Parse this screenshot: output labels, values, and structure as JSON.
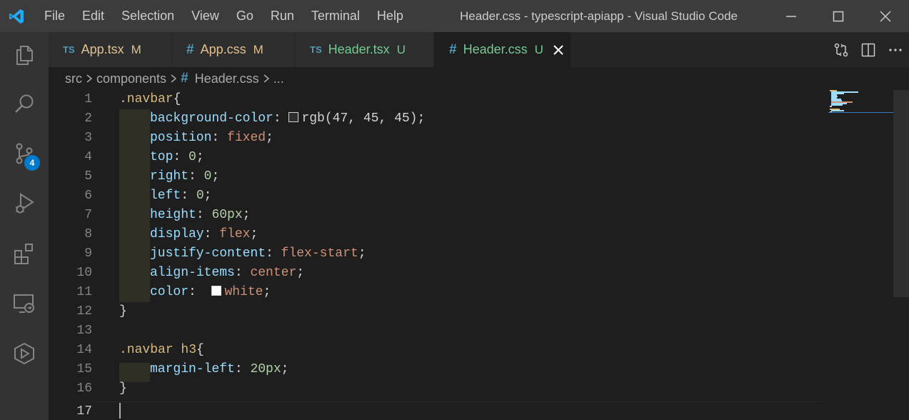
{
  "window": {
    "title": "Header.css - typescript-apiapp - Visual Studio Code",
    "menu": [
      "File",
      "Edit",
      "Selection",
      "View",
      "Go",
      "Run",
      "Terminal",
      "Help"
    ]
  },
  "activity_bar": {
    "items": [
      "explorer-icon",
      "search-icon",
      "source-control-icon",
      "run-debug-icon",
      "extensions-icon",
      "remote-explorer-icon",
      "deploy-icon"
    ],
    "source_control_badge": "4"
  },
  "tabs": [
    {
      "type": "TS",
      "name": "App.tsx",
      "status": "M",
      "color": "#e2c08d"
    },
    {
      "type": "#",
      "name": "App.css",
      "status": "M",
      "color": "#e2c08d"
    },
    {
      "type": "TS",
      "name": "Header.tsx",
      "status": "U",
      "color": "#73c991"
    },
    {
      "type": "#",
      "name": "Header.css",
      "status": "U",
      "color": "#73c991",
      "active": true
    }
  ],
  "breadcrumb": {
    "parts": [
      "src",
      "components",
      "Header.css",
      "..."
    ]
  },
  "editor": {
    "line_numbers": [
      "1",
      "2",
      "3",
      "4",
      "5",
      "6",
      "7",
      "8",
      "9",
      "10",
      "11",
      "12",
      "13",
      "14",
      "15",
      "16",
      "17"
    ],
    "l1": {
      "selector": ".navbar",
      "brace": "{"
    },
    "l2": {
      "prop": "background-color",
      "colon": ":",
      "val": "rgb(47, 45, 45)",
      "semi": ";",
      "swatch": "#2f2d2d"
    },
    "l3": {
      "prop": "position",
      "colon": ":",
      "val": "fixed",
      "semi": ";"
    },
    "l4": {
      "prop": "top",
      "colon": ":",
      "val": "0",
      "semi": ";"
    },
    "l5": {
      "prop": "right",
      "colon": ":",
      "val": "0",
      "semi": ";"
    },
    "l6": {
      "prop": "left",
      "colon": ":",
      "val": "0",
      "semi": ";"
    },
    "l7": {
      "prop": "height",
      "colon": ":",
      "val": "60px",
      "semi": ";"
    },
    "l8": {
      "prop": "display",
      "colon": ":",
      "val": "flex",
      "semi": ";"
    },
    "l9": {
      "prop": "justify-content",
      "colon": ":",
      "val": "flex-start",
      "semi": ";"
    },
    "l10": {
      "prop": "align-items",
      "colon": ":",
      "val": "center",
      "semi": ";"
    },
    "l11": {
      "prop": "color",
      "colon": ":",
      "val": "white",
      "semi": ";",
      "swatch": "#ffffff"
    },
    "l12": {
      "brace": "}"
    },
    "l14": {
      "selector": ".navbar h3",
      "brace": "{"
    },
    "l15": {
      "prop": "margin-left",
      "colon": ":",
      "val": "20px",
      "semi": ";"
    },
    "l16": {
      "brace": "}"
    }
  },
  "colors": {
    "accent": "#007acc",
    "modified": "#e2c08d",
    "untracked": "#73c991"
  }
}
